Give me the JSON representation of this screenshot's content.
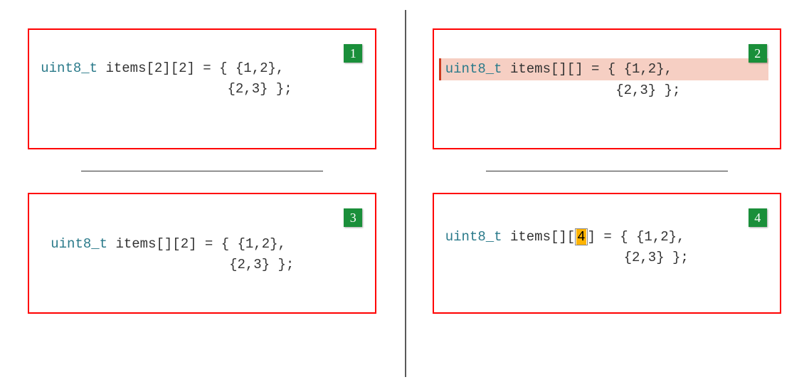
{
  "panels": {
    "p1": {
      "badge": "1",
      "line1_type": "uint8_t",
      "line1_rest": " items[2][2] = { {1,2},",
      "line2": "                       {2,3} };"
    },
    "p2": {
      "badge": "2",
      "line1_type": "uint8_t",
      "line1_rest": " items[][] = { {1,2},",
      "line2": "                     {2,3} };"
    },
    "p3": {
      "badge": "3",
      "line1_type": "uint8_t",
      "line1_rest": " items[][2] = { {1,2},",
      "line2": "                      {2,3} };"
    },
    "p4": {
      "badge": "4",
      "line1_type": "uint8_t",
      "line1_pre": " items[][",
      "line1_sel": "4",
      "line1_post": "] = { {1,2},",
      "line2": "                      {2,3} };"
    }
  }
}
